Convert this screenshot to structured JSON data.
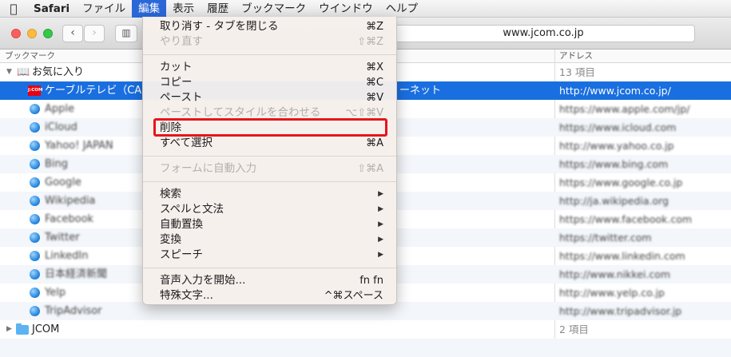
{
  "menubar": {
    "apple_icon": "apple-logo-icon",
    "items": [
      "Safari",
      "ファイル",
      "編集",
      "表示",
      "履歴",
      "ブックマーク",
      "ウインドウ",
      "ヘルプ"
    ],
    "active_index": 2
  },
  "toolbar": {
    "back_glyph": "‹",
    "forward_glyph": "›",
    "sidebar_glyph": "▥",
    "address": "www.jcom.co.jp"
  },
  "columns": {
    "bookmark": "ブックマーク",
    "address": "アドレス"
  },
  "favorites": {
    "label": "お気に入り",
    "count": "13 項目",
    "tri": "▼",
    "icon": "📖"
  },
  "rows": [
    {
      "name": "ケーブルテレビ（CA",
      "name_tail": "ーネット",
      "url": "http://www.jcom.co.jp/",
      "icon": "jcom",
      "jcom_text": "J:COM"
    },
    {
      "name": "Apple",
      "url": "https://www.apple.com/jp/"
    },
    {
      "name": "iCloud",
      "url": "https://www.icloud.com"
    },
    {
      "name": "Yahoo! JAPAN",
      "url": "http://www.yahoo.co.jp"
    },
    {
      "name": "Bing",
      "url": "https://www.bing.com"
    },
    {
      "name": "Google",
      "url": "https://www.google.co.jp"
    },
    {
      "name": "Wikipedia",
      "url": "http://ja.wikipedia.org"
    },
    {
      "name": "Facebook",
      "url": "https://www.facebook.com"
    },
    {
      "name": "Twitter",
      "url": "https://twitter.com"
    },
    {
      "name": "LinkedIn",
      "url": "https://www.linkedin.com"
    },
    {
      "name": "日本経済新聞",
      "url": "http://www.nikkei.com"
    },
    {
      "name": "Yelp",
      "url": "http://www.yelp.co.jp"
    },
    {
      "name": "TripAdvisor",
      "url": "http://www.tripadvisor.jp"
    }
  ],
  "jcom_folder": {
    "label": "JCOM",
    "count": "2 項目",
    "tri": "▶"
  },
  "edit_menu": {
    "undo": {
      "label": "取り消す - タブを閉じる",
      "shortcut": "⌘Z"
    },
    "redo": {
      "label": "やり直す",
      "shortcut": "⇧⌘Z"
    },
    "cut": {
      "label": "カット",
      "shortcut": "⌘X"
    },
    "copy": {
      "label": "コピー",
      "shortcut": "⌘C"
    },
    "paste": {
      "label": "ペースト",
      "shortcut": "⌘V"
    },
    "paste_style": {
      "label": "ペーストしてスタイルを合わせる",
      "shortcut": "⌥⇧⌘V"
    },
    "delete": {
      "label": "削除"
    },
    "select_all": {
      "label": "すべて選択",
      "shortcut": "⌘A"
    },
    "autofill": {
      "label": "フォームに自動入力",
      "shortcut": "⇧⌘A"
    },
    "find": {
      "label": "検索"
    },
    "spelling": {
      "label": "スペルと文法"
    },
    "substitutions": {
      "label": "自動置換"
    },
    "transformations": {
      "label": "変換"
    },
    "speech": {
      "label": "スピーチ"
    },
    "dictation": {
      "label": "音声入力を開始...",
      "shortcut": "fn fn"
    },
    "special_chars": {
      "label": "特殊文字...",
      "shortcut": "^⌘スペース"
    },
    "submenu_arrow": "▶"
  },
  "colors": {
    "selection": "#1a6fe0",
    "menu_active": "#2a68d8",
    "highlight_box": "#e8141c"
  }
}
